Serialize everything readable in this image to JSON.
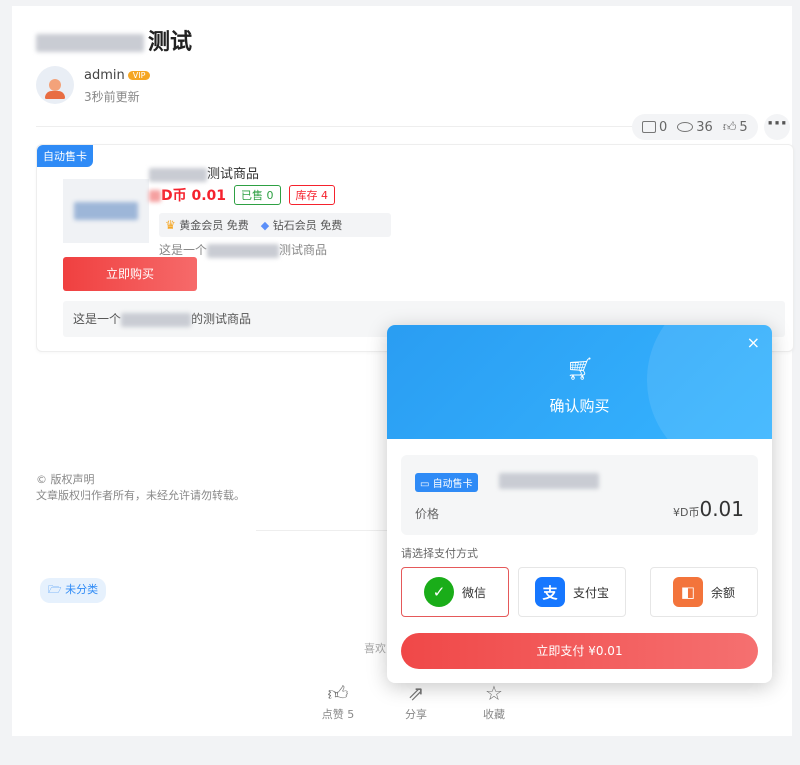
{
  "article": {
    "title_suffix": "测试"
  },
  "author": {
    "name": "admin",
    "badge": "VIP",
    "updated": "3秒前更新"
  },
  "stats": {
    "comments": "0",
    "views": "36",
    "likes": "5",
    "more": "···"
  },
  "product": {
    "tag": "自动售卡",
    "name_suffix": "测试商品",
    "currency": "D币",
    "price": "0.01",
    "sold": "已售 0",
    "stock": "库存 4",
    "gold_member": "黄金会员 免费",
    "diamond_member": "钻石会员 免费",
    "desc_prefix": "这是一个",
    "desc_suffix": "测试商品",
    "buy_label": "立即购买",
    "desc_box_prefix": "这是一个",
    "desc_box_suffix": "的测试商品"
  },
  "copyright": {
    "title": "© 版权声明",
    "text": "文章版权归作者所有，未经允许请勿转载。"
  },
  "category": "未分类",
  "share_tip": "喜欢",
  "actions": [
    {
      "icon": "thumbs-up-icon",
      "label": "点赞 5"
    },
    {
      "icon": "share-icon",
      "label": "分享"
    },
    {
      "icon": "star-icon",
      "label": "收藏"
    }
  ],
  "modal": {
    "title": "确认购买",
    "close": "×",
    "product_tag": "自动售卡",
    "price_label": "价格",
    "currency": "¥D币",
    "price": "0.01",
    "pay_method_label": "请选择支付方式",
    "methods": [
      {
        "label": "微信"
      },
      {
        "label": "支付宝"
      },
      {
        "label": "余额"
      }
    ],
    "pay_button": "立即支付 ¥0.01"
  },
  "colors": {
    "accent": "#2f8bf6",
    "buy": "#f04040",
    "price": "#f5222d"
  }
}
